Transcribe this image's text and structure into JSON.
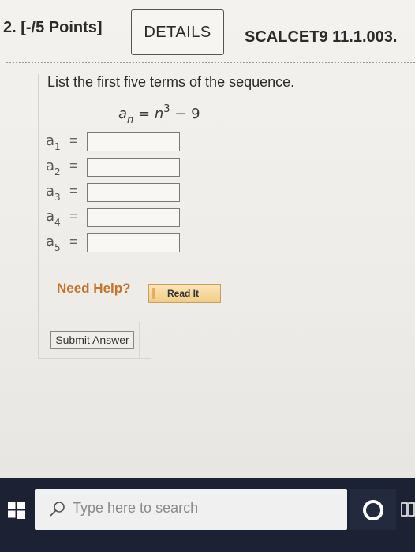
{
  "header": {
    "points_label": "2.  [-/5 Points]",
    "details_label": "DETAILS",
    "problem_code": "SCALCET9 11.1.003."
  },
  "question": {
    "prompt": "List the first five terms of the sequence.",
    "formula": {
      "lhs_base": "a",
      "lhs_sub": "n",
      "equals": "=",
      "var": "n",
      "exponent": "3",
      "rest": "− 9"
    },
    "terms": [
      {
        "base": "a",
        "sub": "1",
        "value": ""
      },
      {
        "base": "a",
        "sub": "2",
        "value": ""
      },
      {
        "base": "a",
        "sub": "3",
        "value": ""
      },
      {
        "base": "a",
        "sub": "4",
        "value": ""
      },
      {
        "base": "a",
        "sub": "5",
        "value": ""
      }
    ],
    "eq": "="
  },
  "help": {
    "need_help_label": "Need Help?",
    "read_it_label": "Read It"
  },
  "submit_label": "Submit Answer",
  "taskbar": {
    "search_placeholder": "Type here to search",
    "start_icon": "windows-logo-icon",
    "search_icon": "magnifier-icon",
    "cortana_icon": "cortana-ring-icon",
    "taskview_icon": "task-view-icon",
    "background_color": "#1c2233"
  },
  "colors": {
    "need_help": "#c5742a",
    "read_it_bg": "#f2cd86"
  }
}
